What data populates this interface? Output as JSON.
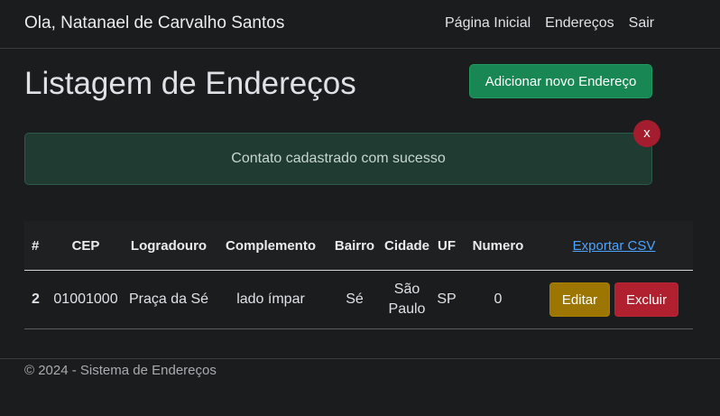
{
  "navbar": {
    "brand": "Ola, Natanael de Carvalho Santos",
    "links": [
      "Página Inicial",
      "Endereços",
      "Sair"
    ]
  },
  "page": {
    "title": "Listagem de Endereços",
    "add_button": "Adicionar novo Endereço"
  },
  "alert": {
    "message": "Contato cadastrado com sucesso",
    "close_label": "x"
  },
  "table": {
    "headers": [
      "#",
      "CEP",
      "Logradouro",
      "Complemento",
      "Bairro",
      "Cidade",
      "UF",
      "Numero"
    ],
    "export_label": "Exportar CSV",
    "rows": [
      {
        "id": "2",
        "cep": "01001000",
        "logradouro": "Praça da Sé",
        "complemento": "lado ímpar",
        "bairro": "Sé",
        "cidade": "São Paulo",
        "uf": "SP",
        "numero": "0",
        "edit_label": "Editar",
        "delete_label": "Excluir"
      }
    ]
  },
  "footer": {
    "text": "© 2024 - Sistema de Endereços"
  },
  "colors": {
    "background": "#1b1c1e",
    "success": "#198754",
    "warning": "#9c7600",
    "danger": "#b0202f",
    "link": "#4da3ff"
  }
}
